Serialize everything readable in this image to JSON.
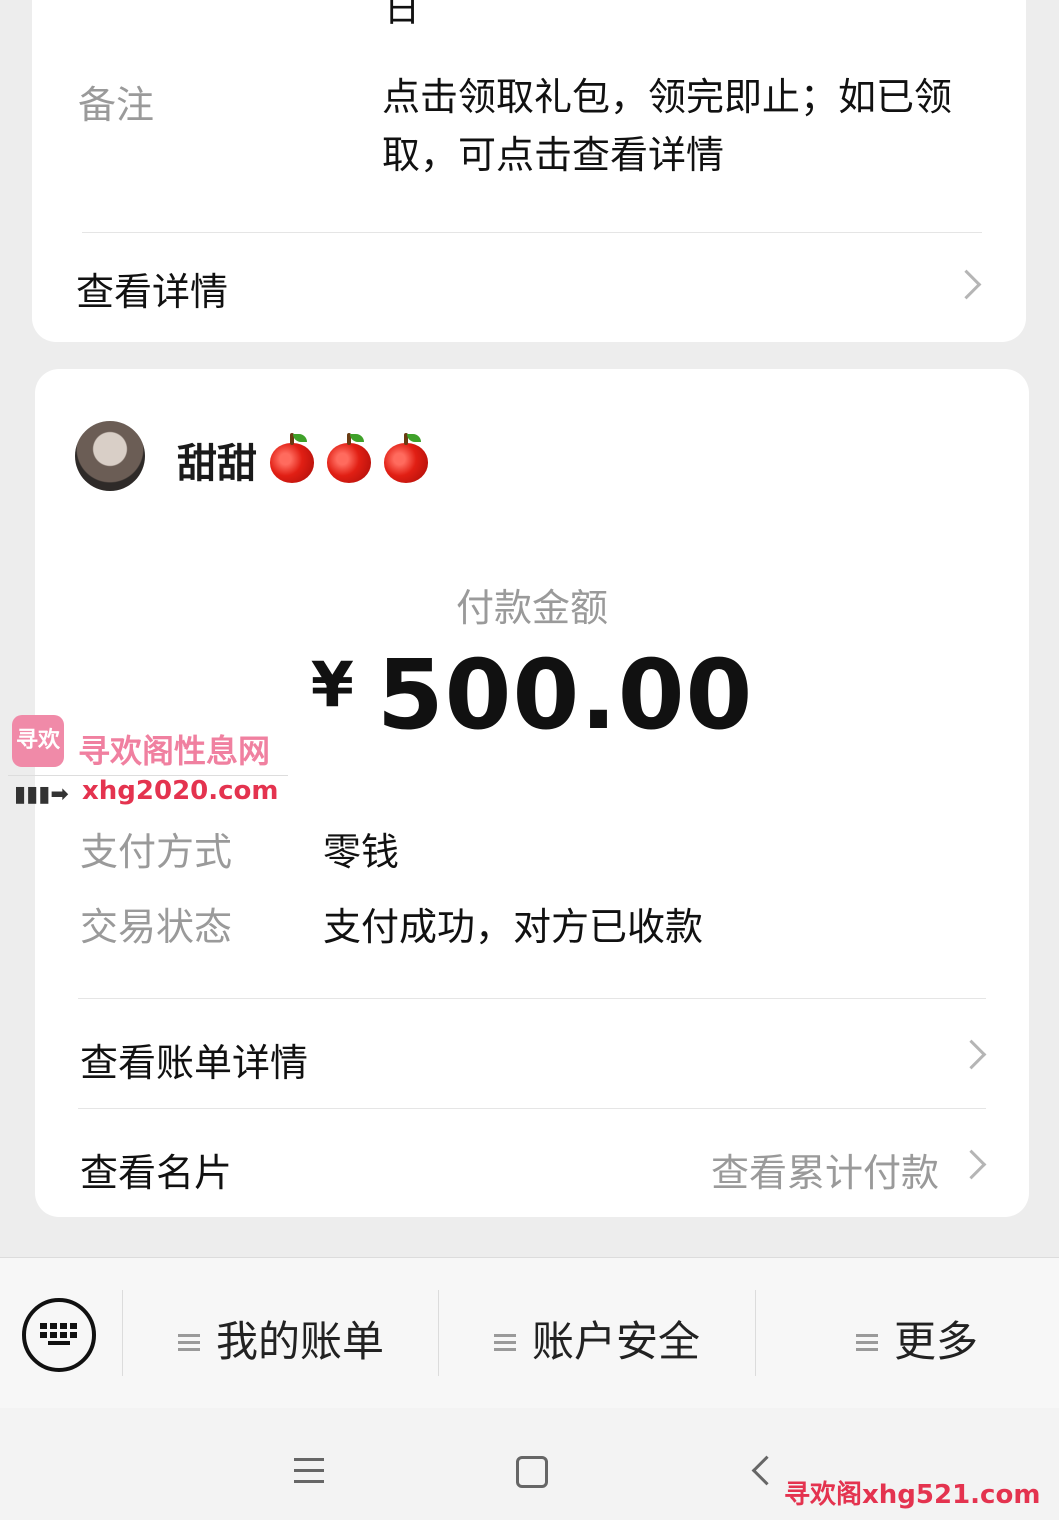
{
  "top_card": {
    "date_tail": "日",
    "remark_label": "备注",
    "remark_value": "点击领取礼包，领完即止；如已领取，可点击查看详情",
    "view_details": "查看详情"
  },
  "payment": {
    "payee_name": "甜甜",
    "payee_emoji_count": 3,
    "amount_label": "付款金额",
    "currency_symbol": "¥",
    "amount": "500.00",
    "method_label": "支付方式",
    "method_value": "零钱",
    "status_label": "交易状态",
    "status_value": "支付成功，对方已收款",
    "bill_details": "查看账单详情",
    "view_card": "查看名片",
    "view_total": "查看累计付款"
  },
  "menu_bar": {
    "items": [
      "我的账单",
      "账户安全",
      "更多"
    ]
  },
  "watermark": {
    "logo_text": "寻欢",
    "site_name": "寻欢阁性息网",
    "url_1": "xhg2020.com",
    "url_2": "寻欢阁xhg521.com"
  },
  "colors": {
    "background": "#ededed",
    "card": "#ffffff",
    "secondary_text": "#9a9a9a",
    "watermark_red": "#e4334f"
  }
}
